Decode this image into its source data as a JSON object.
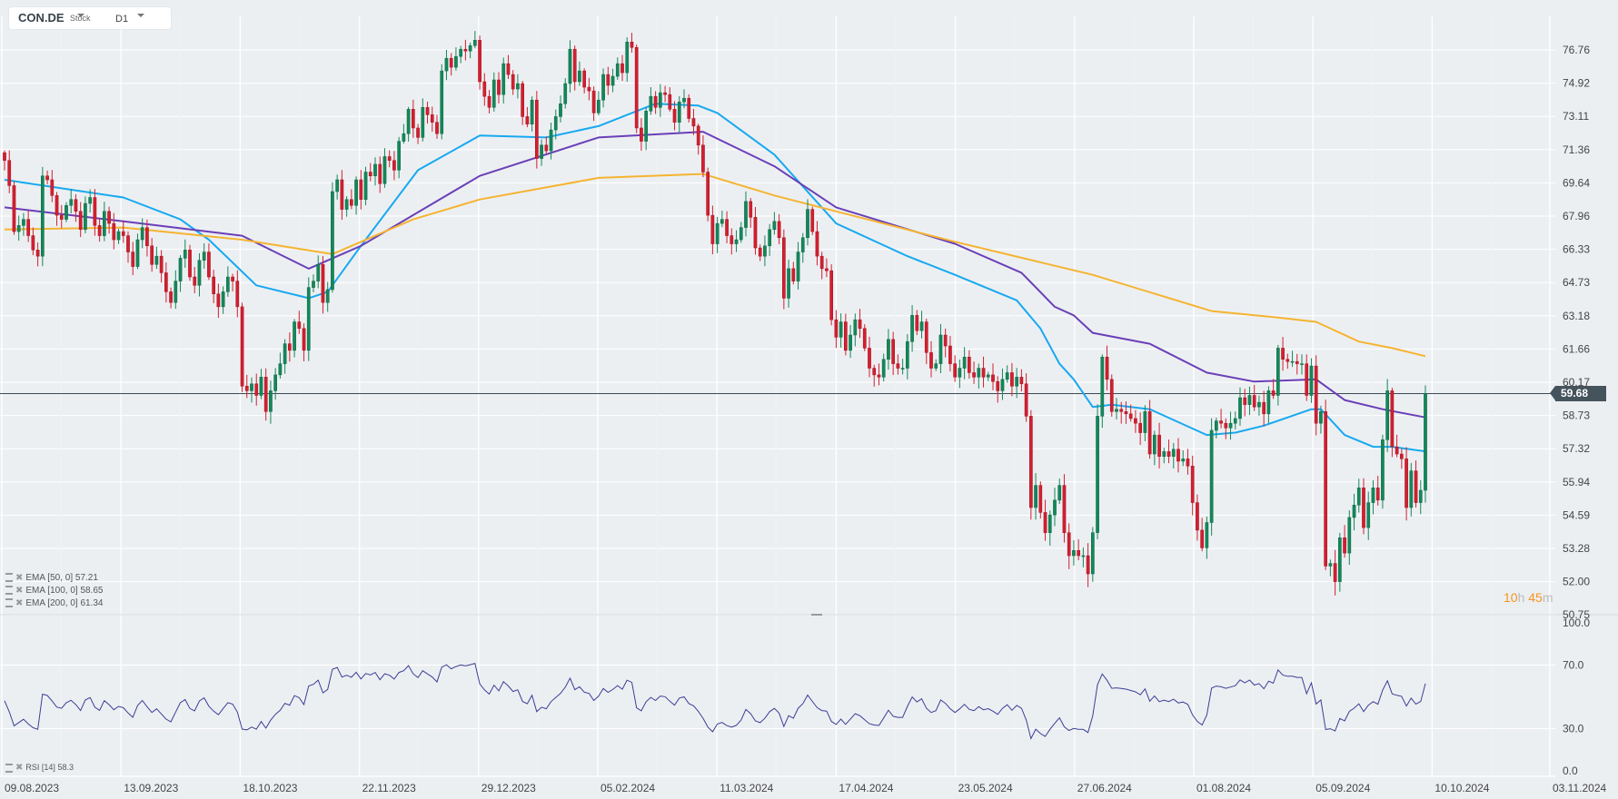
{
  "header": {
    "symbol": "CON.DE",
    "type": "Stock",
    "timeframe": "D1"
  },
  "indicators": [
    {
      "label": "EMA",
      "params": "[50,  0]",
      "value": "57.21",
      "color": "#17a9f0"
    },
    {
      "label": "EMA",
      "params": "[100,  0]",
      "value": "58.65",
      "color": "#6a3fb8"
    },
    {
      "label": "EMA",
      "params": "[200,  0]",
      "value": "61.34",
      "color": "#f5b431"
    }
  ],
  "rsi_legend": {
    "label": "RSI",
    "params": "[14]",
    "value": "58.3",
    "color": "#3c3f94"
  },
  "countdown": {
    "hours": "10",
    "h": "h",
    "minutes": "45",
    "m": "m"
  },
  "current_price": "59.68",
  "colors": {
    "up": "#14875a",
    "down": "#d21f30",
    "background": "#eceff2",
    "price_line": "#3d4a53"
  },
  "chart_data": {
    "type": "candlestick",
    "title": "CON.DE D1",
    "price_ticks": [
      "76.76",
      "74.92",
      "73.11",
      "71.36",
      "69.64",
      "67.96",
      "66.33",
      "64.73",
      "63.18",
      "61.66",
      "60.17",
      "58.73",
      "57.32",
      "55.94",
      "54.59",
      "53.28",
      "52.00",
      "50.75"
    ],
    "rsi_ticks": [
      "100.0",
      "70.0",
      "30.0",
      "0.0"
    ],
    "date_ticks": [
      "09.08.2023",
      "13.09.2023",
      "18.10.2023",
      "22.11.2023",
      "29.12.2023",
      "05.02.2024",
      "11.03.2024",
      "17.04.2024",
      "23.05.2024",
      "27.06.2024",
      "01.08.2024",
      "05.09.2024",
      "10.10.2024",
      "03.11.2024"
    ],
    "first_open": 71.2,
    "closes": [
      70.8,
      69.5,
      67.2,
      67.5,
      67.8,
      67.0,
      66.3,
      66.0,
      70.0,
      69.8,
      69.0,
      68.0,
      67.8,
      68.5,
      68.8,
      68.2,
      67.3,
      68.6,
      68.9,
      67.5,
      67.0,
      68.2,
      67.6,
      66.8,
      67.2,
      67.0,
      66.2,
      65.5,
      66.8,
      67.4,
      66.5,
      65.6,
      66.0,
      65.2,
      64.3,
      63.8,
      64.8,
      65.9,
      66.3,
      65.0,
      64.6,
      65.8,
      66.2,
      65.0,
      64.2,
      63.6,
      64.3,
      65.0,
      64.8,
      63.6,
      60.0,
      59.8,
      60.1,
      59.6,
      60.4,
      58.9,
      59.8,
      60.5,
      61.0,
      61.9,
      61.6,
      62.9,
      62.6,
      61.6,
      64.5,
      64.8,
      65.6,
      63.8,
      64.4,
      69.2,
      69.8,
      68.3,
      68.8,
      68.5,
      69.8,
      68.8,
      70.2,
      70.0,
      70.6,
      69.6,
      71.0,
      70.8,
      70.3,
      71.8,
      72.2,
      73.5,
      72.5,
      72.0,
      73.6,
      73.2,
      72.8,
      72.2,
      75.6,
      76.3,
      75.8,
      76.4,
      76.8,
      76.7,
      77.0,
      77.3,
      75.0,
      74.2,
      73.6,
      75.1,
      74.3,
      76.0,
      75.4,
      74.6,
      74.9,
      73.1,
      72.7,
      74.0,
      70.9,
      71.6,
      71.3,
      72.4,
      73.1,
      73.8,
      74.9,
      76.8,
      75.0,
      75.6,
      74.7,
      74.5,
      73.3,
      74.0,
      75.4,
      74.8,
      75.3,
      76.0,
      75.5,
      77.2,
      76.9,
      72.5,
      71.8,
      73.4,
      74.2,
      73.6,
      74.4,
      74.3,
      73.5,
      72.8,
      73.9,
      74.1,
      73.0,
      72.6,
      71.6,
      70.2,
      68.0,
      66.6,
      67.6,
      67.8,
      67.0,
      66.6,
      66.8,
      67.4,
      68.7,
      67.9,
      66.4,
      66.0,
      66.5,
      67.3,
      67.7,
      66.9,
      64.0,
      65.4,
      64.8,
      66.2,
      66.9,
      68.3,
      67.2,
      66.0,
      65.4,
      65.3,
      63.0,
      62.2,
      62.9,
      61.6,
      62.3,
      63.0,
      62.6,
      61.7,
      60.8,
      60.5,
      60.4,
      61.2,
      62.1,
      61.0,
      60.8,
      60.8,
      62.0,
      63.2,
      62.5,
      62.9,
      61.5,
      60.8,
      61.0,
      62.3,
      61.8,
      61.0,
      60.4,
      60.8,
      61.3,
      60.6,
      60.4,
      60.8,
      60.4,
      60.5,
      60.2,
      59.8,
      60.3,
      60.6,
      60.0,
      60.4,
      60.1,
      58.7,
      54.9,
      55.8,
      54.7,
      53.9,
      54.6,
      55.2,
      55.8,
      53.9,
      53.0,
      53.2,
      53.0,
      53.0,
      52.3,
      53.9,
      58.7,
      61.3,
      60.3,
      58.9,
      59.0,
      58.9,
      58.8,
      58.6,
      58.4,
      58.0,
      58.9,
      57.1,
      57.9,
      57.0,
      57.2,
      57.0,
      57.3,
      56.8,
      56.9,
      56.6,
      55.1,
      54.0,
      53.3,
      54.3,
      58.1,
      58.5,
      58.4,
      58.2,
      58.4,
      58.6,
      59.5,
      59.2,
      59.6,
      59.1,
      59.3,
      58.8,
      59.8,
      59.6,
      61.7,
      61.2,
      61.1,
      61.1,
      61.0,
      61.0,
      59.6,
      60.9,
      58.4,
      58.9,
      52.6,
      52.7,
      52.0,
      53.7,
      53.1,
      54.5,
      55.0,
      55.7,
      54.1,
      55.1,
      55.7,
      55.2,
      57.7,
      59.8,
      57.4,
      57.1,
      56.9,
      54.9,
      56.4,
      55.1,
      55.6,
      59.68
    ],
    "ema_series": [
      {
        "name": "EMA 50",
        "color": "#17a9f0",
        "knots": [
          [
            0,
            69.8
          ],
          [
            25,
            68.9
          ],
          [
            37,
            67.8
          ],
          [
            43,
            66.8
          ],
          [
            53,
            64.6
          ],
          [
            64,
            64.0
          ],
          [
            68,
            64.3
          ],
          [
            75,
            66.5
          ],
          [
            87,
            70.3
          ],
          [
            100,
            72.1
          ],
          [
            114,
            72.0
          ],
          [
            125,
            72.6
          ],
          [
            137,
            73.8
          ],
          [
            146,
            73.7
          ],
          [
            150,
            73.3
          ],
          [
            162,
            71.1
          ],
          [
            175,
            67.6
          ],
          [
            190,
            66.0
          ],
          [
            200,
            65.1
          ],
          [
            213,
            63.9
          ],
          [
            218,
            62.6
          ],
          [
            222,
            61.0
          ],
          [
            225,
            60.3
          ],
          [
            229,
            59.1
          ],
          [
            233,
            59.2
          ],
          [
            241,
            59.0
          ],
          [
            253,
            57.9
          ],
          [
            259,
            58.0
          ],
          [
            265,
            58.3
          ],
          [
            275,
            59.0
          ],
          [
            277,
            59.0
          ],
          [
            282,
            57.9
          ],
          [
            288,
            57.4
          ],
          [
            292,
            57.4
          ],
          [
            299,
            57.21
          ]
        ]
      },
      {
        "name": "EMA 100",
        "color": "#6a3fb8",
        "knots": [
          [
            0,
            68.4
          ],
          [
            25,
            67.7
          ],
          [
            50,
            67.0
          ],
          [
            64,
            65.4
          ],
          [
            75,
            66.5
          ],
          [
            100,
            70.0
          ],
          [
            125,
            72.0
          ],
          [
            147,
            72.3
          ],
          [
            162,
            70.5
          ],
          [
            175,
            68.4
          ],
          [
            200,
            66.6
          ],
          [
            214,
            65.2
          ],
          [
            221,
            63.6
          ],
          [
            225,
            63.2
          ],
          [
            229,
            62.4
          ],
          [
            241,
            61.9
          ],
          [
            253,
            60.6
          ],
          [
            263,
            60.2
          ],
          [
            276,
            60.3
          ],
          [
            282,
            59.4
          ],
          [
            290,
            59.0
          ],
          [
            299,
            58.65
          ]
        ]
      },
      {
        "name": "EMA 200",
        "color": "#f5b431",
        "knots": [
          [
            0,
            67.3
          ],
          [
            25,
            67.4
          ],
          [
            50,
            66.8
          ],
          [
            69,
            66.1
          ],
          [
            86,
            67.8
          ],
          [
            100,
            68.8
          ],
          [
            125,
            69.9
          ],
          [
            147,
            70.1
          ],
          [
            162,
            69.0
          ],
          [
            175,
            68.2
          ],
          [
            200,
            66.7
          ],
          [
            229,
            65.1
          ],
          [
            254,
            63.4
          ],
          [
            268,
            63.1
          ],
          [
            276,
            62.9
          ],
          [
            285,
            62.0
          ],
          [
            292,
            61.7
          ],
          [
            299,
            61.34
          ]
        ]
      }
    ],
    "rsi_period": 14,
    "rsi_range": [
      0,
      100
    ]
  }
}
